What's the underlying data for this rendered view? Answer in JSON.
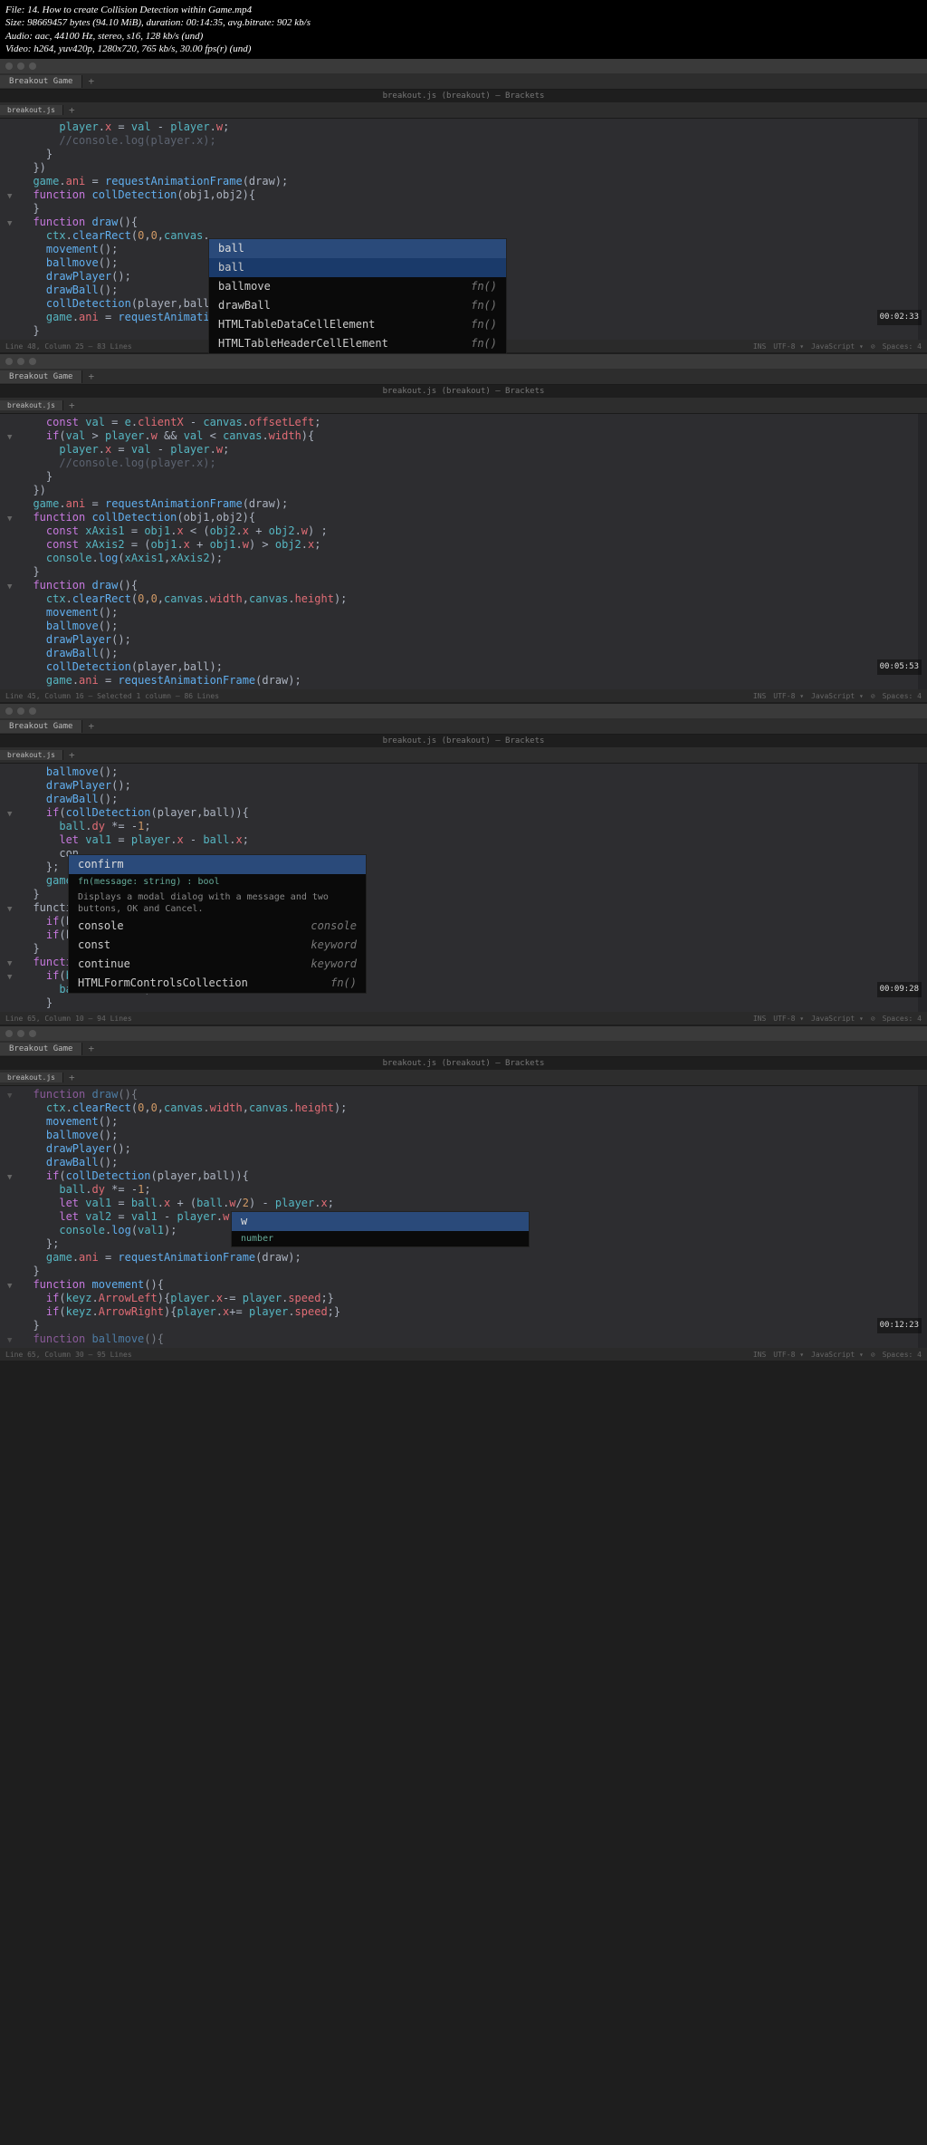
{
  "header": {
    "file": "File: 14. How to create Collision Detection within Game.mp4",
    "size": "Size: 98669457 bytes (94.10 MiB), duration: 00:14:35, avg.bitrate: 902 kb/s",
    "audio": "Audio: aac, 44100 Hz, stereo, s16, 128 kb/s (und)",
    "video": "Video: h264, yuv420p, 1280x720, 765 kb/s, 30.00 fps(r) (und)"
  },
  "common": {
    "tab_outer": "Breakout Game",
    "tab_inner": "breakout.js",
    "plus": "+"
  },
  "pane1": {
    "title": "breakout.js (breakout) — Brackets",
    "timestamp": "00:02:33",
    "status_left": "Line 48, Column 25 — 83 Lines",
    "status_right": [
      "INS",
      "UTF-8 ▾",
      "JavaScript ▾",
      "⊘",
      "Spaces: 4"
    ],
    "code": [
      {
        "i": 0,
        "t": "      player.x = val - player.w;"
      },
      {
        "i": 0,
        "t": "      //console.log(player.x);",
        "cls": "comment"
      },
      {
        "i": 0,
        "t": "    }"
      },
      {
        "i": 0,
        "t": "  })"
      },
      {
        "i": 0,
        "t": "  game.ani = requestAnimationFrame(draw);"
      },
      {
        "i": 0,
        "t": ""
      },
      {
        "i": 0,
        "t": "  function collDetection(obj1,obj2){",
        "fold": "▼"
      },
      {
        "i": 0,
        "t": ""
      },
      {
        "i": 0,
        "t": "  }"
      },
      {
        "i": 0,
        "t": "  function draw(){",
        "fold": "▼"
      },
      {
        "i": 0,
        "t": "    ctx.clearRect(0,0,canvas."
      },
      {
        "i": 0,
        "t": "    movement();"
      },
      {
        "i": 0,
        "t": "    ballmove();"
      },
      {
        "i": 0,
        "t": "    drawPlayer();"
      },
      {
        "i": 0,
        "t": "    drawBall();"
      },
      {
        "i": 0,
        "t": "    collDetection(player,ball)"
      },
      {
        "i": 0,
        "t": "    game.ani = requestAnimationFrame(draw);"
      },
      {
        "i": 0,
        "t": "  }"
      }
    ],
    "ac": {
      "header": "ball",
      "rows": [
        {
          "l": "ball",
          "r": "",
          "sel": true
        },
        {
          "l": "ballmove",
          "r": "fn()"
        },
        {
          "l": "drawBall",
          "r": "fn()"
        },
        {
          "l": "HTMLTableDataCellElement",
          "r": "fn()"
        },
        {
          "l": "HTMLTableHeaderCellElement",
          "r": "fn()"
        }
      ]
    }
  },
  "pane2": {
    "title": "breakout.js (breakout) — Brackets",
    "timestamp": "00:05:53",
    "status_left": "Line 45, Column 16 — Selected 1 column — 86 Lines",
    "status_right": [
      "INS",
      "UTF-8 ▾",
      "JavaScript ▾",
      "⊘",
      "Spaces: 4"
    ],
    "code": [
      {
        "t": "    const val = e.clientX - canvas.offsetLeft;"
      },
      {
        "t": "    if(val > player.w && val < canvas.width){",
        "fold": "▼"
      },
      {
        "t": "      player.x = val - player.w;"
      },
      {
        "t": "      //console.log(player.x);",
        "cls": "comment"
      },
      {
        "t": "    }"
      },
      {
        "t": "  })"
      },
      {
        "t": "  game.ani = requestAnimationFrame(draw);"
      },
      {
        "t": ""
      },
      {
        "t": "  function collDetection(obj1,obj2){",
        "fold": "▼"
      },
      {
        "t": "    const xAxis1 = obj1.x < (obj2.x + obj2.w) ;"
      },
      {
        "t": "    const xAxis2 = (obj1.x + obj1.w) > obj2.x;"
      },
      {
        "t": "    console.log(xAxis1,xAxis2);"
      },
      {
        "t": "  }"
      },
      {
        "t": "  function draw(){",
        "fold": "▼"
      },
      {
        "t": "    ctx.clearRect(0,0,canvas.width,canvas.height);"
      },
      {
        "t": "    movement();"
      },
      {
        "t": "    ballmove();"
      },
      {
        "t": "    drawPlayer();"
      },
      {
        "t": "    drawBall();"
      },
      {
        "t": "    collDetection(player,ball);"
      },
      {
        "t": "    game.ani = requestAnimationFrame(draw);"
      }
    ]
  },
  "pane3": {
    "title": "breakout.js (breakout) — Brackets",
    "timestamp": "00:09:28",
    "status_left": "Line 65, Column 10 — 94 Lines",
    "status_right": [
      "INS",
      "UTF-8 ▾",
      "JavaScript ▾",
      "⊘",
      "Spaces: 4"
    ],
    "code": [
      {
        "t": "    ballmove();"
      },
      {
        "t": "    drawPlayer();"
      },
      {
        "t": "    drawBall();"
      },
      {
        "t": "    if(collDetection(player,ball)){",
        "fold": "▼"
      },
      {
        "t": "      ball.dy *= -1;"
      },
      {
        "t": "      let val1 = player.x - ball.x;"
      },
      {
        "t": "      con"
      },
      {
        "t": "    };"
      },
      {
        "t": "    game."
      },
      {
        "t": "  }"
      },
      {
        "t": ""
      },
      {
        "t": ""
      },
      {
        "t": "  functio",
        "fold": "▼"
      },
      {
        "t": "    if(ke"
      },
      {
        "t": "    if(ke"
      },
      {
        "t": "  }"
      },
      {
        "t": "  function ballmove(){",
        "fold": "▼"
      },
      {
        "t": "    if(ball.x > canvas.width || ball.x < 0  ){",
        "fold": "▼"
      },
      {
        "t": "      ball.dx *= -1;"
      },
      {
        "t": "    }"
      }
    ],
    "ac": {
      "header": "confirm",
      "sig": "fn(message: string) : bool",
      "desc": "Displays a modal dialog with a message and two buttons, OK and Cancel.",
      "rows": [
        {
          "l": "console",
          "r": "console"
        },
        {
          "l": "const",
          "r": "keyword"
        },
        {
          "l": "continue",
          "r": "keyword"
        },
        {
          "l": "HTMLFormControlsCollection",
          "r": "fn()"
        }
      ]
    }
  },
  "pane4": {
    "title": "breakout.js (breakout) — Brackets",
    "timestamp": "00:12:23",
    "status_left": "Line 65, Column 30 — 95 Lines",
    "status_right": [
      "INS",
      "UTF-8 ▾",
      "JavaScript ▾",
      "⊘",
      "Spaces: 4"
    ],
    "code": [
      {
        "t": "  function draw(){",
        "fold": "▼",
        "dim": true
      },
      {
        "t": "    ctx.clearRect(0,0,canvas.width,canvas.height);"
      },
      {
        "t": "    movement();"
      },
      {
        "t": "    ballmove();"
      },
      {
        "t": "    drawPlayer();"
      },
      {
        "t": "    drawBall();"
      },
      {
        "t": "    if(collDetection(player,ball)){",
        "fold": "▼"
      },
      {
        "t": "      ball.dy *= -1;"
      },
      {
        "t": "      let val1 = ball.x + (ball.w/2) - player.x;"
      },
      {
        "t": "      let val2 = val1 - player.w"
      },
      {
        "t": "      console.log(val1);"
      },
      {
        "t": "    };"
      },
      {
        "t": "    game.ani = requestAnimationFrame(draw);"
      },
      {
        "t": "  }"
      },
      {
        "t": ""
      },
      {
        "t": ""
      },
      {
        "t": "  function movement(){",
        "fold": "▼"
      },
      {
        "t": "    if(keyz.ArrowLeft){player.x-= player.speed;}"
      },
      {
        "t": "    if(keyz.ArrowRight){player.x+= player.speed;}"
      },
      {
        "t": "  }"
      },
      {
        "t": "  function ballmove(){",
        "fold": "▼",
        "dim": true
      }
    ],
    "ac": {
      "header": "w",
      "sig": "number"
    }
  }
}
